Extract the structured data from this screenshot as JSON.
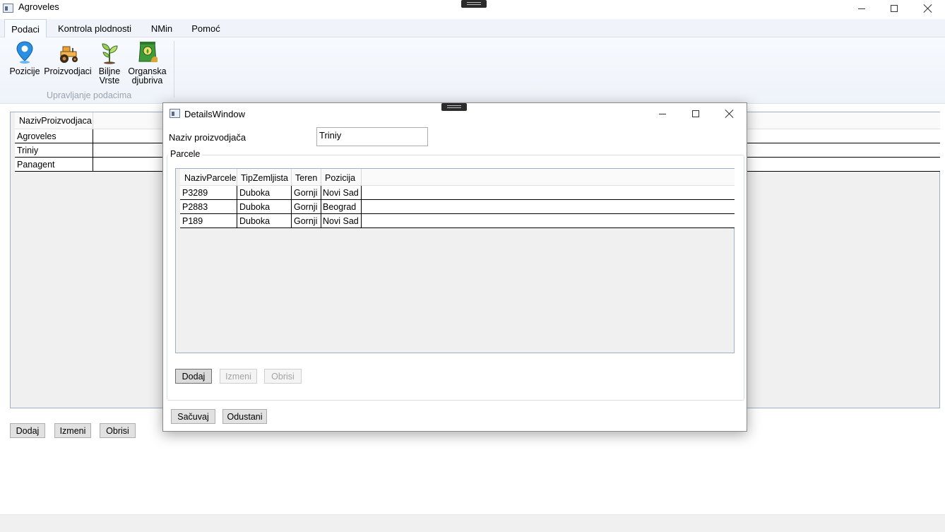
{
  "window": {
    "title": "Agroveles"
  },
  "ribbon": {
    "tabs": [
      {
        "label": "Podaci",
        "active": true
      },
      {
        "label": "Kontrola plodnosti",
        "active": false
      },
      {
        "label": "NMin",
        "active": false
      },
      {
        "label": "Pomoć",
        "active": false
      }
    ],
    "buttons": [
      {
        "label": "Pozicije",
        "icon": "map-pin-icon"
      },
      {
        "label": "Proizvodjaci",
        "icon": "tractor-icon"
      },
      {
        "label_line1": "Biljne",
        "label_line2": "Vrste",
        "icon": "plant-icon"
      },
      {
        "label_line1": "Organska",
        "label_line2": "djubriva",
        "icon": "fertilizer-bag-icon"
      }
    ],
    "group_label": "Upravljanje podacima"
  },
  "main_grid": {
    "column_header": "NazivProizvodjaca",
    "rows": [
      "Agroveles",
      "Triniy",
      "Panagent"
    ]
  },
  "main_buttons": {
    "add": "Dodaj",
    "edit": "Izmeni",
    "delete": "Obrisi"
  },
  "dialog": {
    "title": "DetailsWindow",
    "field_label": "Naziv proizvodjača",
    "field_value": "Triniy",
    "group_label": "Parcele",
    "grid": {
      "headers": [
        "NazivParcele",
        "TipZemljista",
        "Teren",
        "Pozicija"
      ],
      "rows": [
        [
          "P3289",
          "Duboka",
          "Gornji",
          "Novi Sad"
        ],
        [
          "P2883",
          "Duboka",
          "Gornji",
          "Beograd"
        ],
        [
          "P189",
          "Duboka",
          "Gornji",
          "Novi Sad"
        ]
      ]
    },
    "grid_buttons": {
      "add": "Dodaj",
      "edit": "Izmeni",
      "delete": "Obrisi",
      "edit_disabled": true,
      "delete_disabled": true
    },
    "footer_buttons": {
      "save": "Sačuvaj",
      "cancel": "Odustani"
    }
  },
  "colors": {
    "accent": "#0078d7",
    "grid_border": "#9fb0c6",
    "ribbon_bg": "#f0f4fa"
  }
}
